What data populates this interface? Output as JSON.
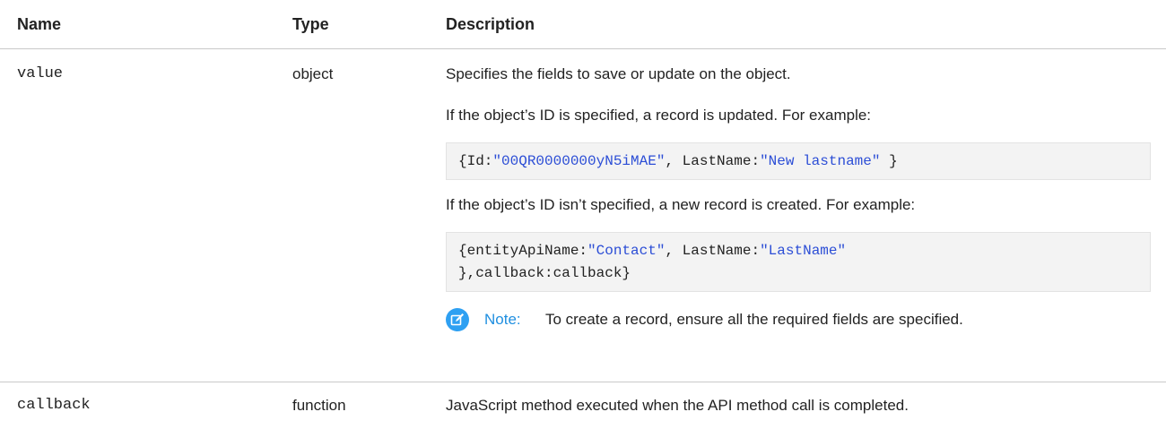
{
  "table": {
    "headers": {
      "name": "Name",
      "type": "Type",
      "description": "Description"
    },
    "value_row": {
      "name": "value",
      "type": "object",
      "desc1": "Specifies the fields to save or update on the object.",
      "desc2": "If the object’s ID is specified, a record is updated. For example:",
      "code1": {
        "p1": "{Id:",
        "s1": "\"00QR0000000yN5iMAE\"",
        "p2": ", LastName:",
        "s2": "\"New lastname\"",
        "p3": " }"
      },
      "desc3": "If the object’s ID isn’t specified, a new record is created. For example:",
      "code2": {
        "p1": "{entityApiName:",
        "s1": "\"Contact\"",
        "p2": ", LastName:",
        "s2": "\"LastName\"",
        "line2": "},callback:callback}"
      },
      "note": {
        "icon": "note-edit-icon",
        "label": "Note:",
        "text": "To create a record, ensure all the required fields are specified."
      }
    },
    "callback_row": {
      "name": "callback",
      "type": "function",
      "description": "JavaScript method executed when the API method call is completed."
    }
  },
  "colors": {
    "string_literal": "#2c4ed6",
    "note_accent": "#2ea0f2",
    "code_bg": "#f3f3f3"
  }
}
